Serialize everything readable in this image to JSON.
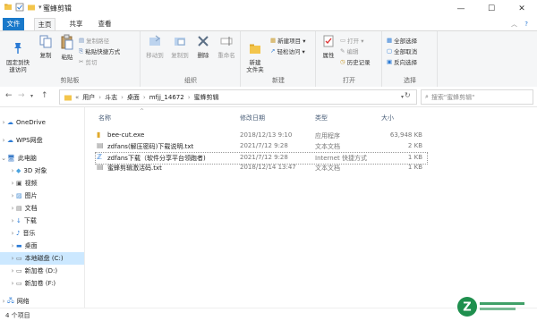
{
  "window": {
    "title": "蜜蜂剪辑"
  },
  "tabs": [
    {
      "label": "文件"
    },
    {
      "label": "主页"
    },
    {
      "label": "共享"
    },
    {
      "label": "查看"
    }
  ],
  "ribbon": {
    "clipboard": {
      "pin_label": "固定到快\n速访问",
      "copy_label": "复制",
      "paste_label": "粘贴",
      "copy_path": "复制路径",
      "paste_shortcut": "粘贴快捷方式",
      "cut": "剪切",
      "group_label": "剪贴板"
    },
    "organize": {
      "move_to": "移动到",
      "copy_to": "复制到",
      "delete": "删除",
      "rename": "重命名",
      "group_label": "组织"
    },
    "new": {
      "new_folder": "新建\n文件夹",
      "new_item": "新建项目 ▾",
      "easy_access": "轻松访问 ▾",
      "group_label": "新建"
    },
    "open": {
      "properties": "属性",
      "open": "打开 ▾",
      "edit": "编辑",
      "history": "历史记录",
      "group_label": "打开"
    },
    "select": {
      "select_all": "全部选择",
      "select_none": "全部取消",
      "invert": "反向选择",
      "group_label": "选择"
    }
  },
  "address": {
    "crumbs": [
      "用户",
      "斗志",
      "桌面",
      "mfjj_14672",
      "蜜蜂剪辑"
    ],
    "search_placeholder": "搜索\"蜜蜂剪辑\""
  },
  "nav": {
    "items": [
      {
        "label": "OneDrive"
      },
      {
        "label": "WPS网盘"
      },
      {
        "label": "此电脑"
      },
      {
        "label": "3D 对象"
      },
      {
        "label": "视频"
      },
      {
        "label": "图片"
      },
      {
        "label": "文档"
      },
      {
        "label": "下载"
      },
      {
        "label": "音乐"
      },
      {
        "label": "桌面"
      },
      {
        "label": "本地磁盘 (C:)"
      },
      {
        "label": "新加卷 (D:)"
      },
      {
        "label": "新加卷 (F:)"
      },
      {
        "label": "网络"
      }
    ]
  },
  "columns": {
    "name": "名称",
    "modified": "修改日期",
    "type": "类型",
    "size": "大小"
  },
  "files": [
    {
      "name": "bee-cut.exe",
      "modified": "2018/12/13 9:10",
      "type": "应用程序",
      "size": "63,948 KB"
    },
    {
      "name": "zdfans(解压密码)下载说明.txt",
      "modified": "2021/7/12 9:28",
      "type": "文本文档",
      "size": "2 KB"
    },
    {
      "name": "zdfans下载（软件分享平台领跑者)",
      "modified": "2021/7/12 9:28",
      "type": "Internet 快捷方式",
      "size": "1 KB"
    },
    {
      "name": "蜜蜂剪辑激活码.txt",
      "modified": "2018/12/14 13:47",
      "type": "文本文档",
      "size": "1 KB"
    }
  ],
  "status": {
    "count": "4 个项目"
  },
  "logo": {
    "text": "Z"
  }
}
